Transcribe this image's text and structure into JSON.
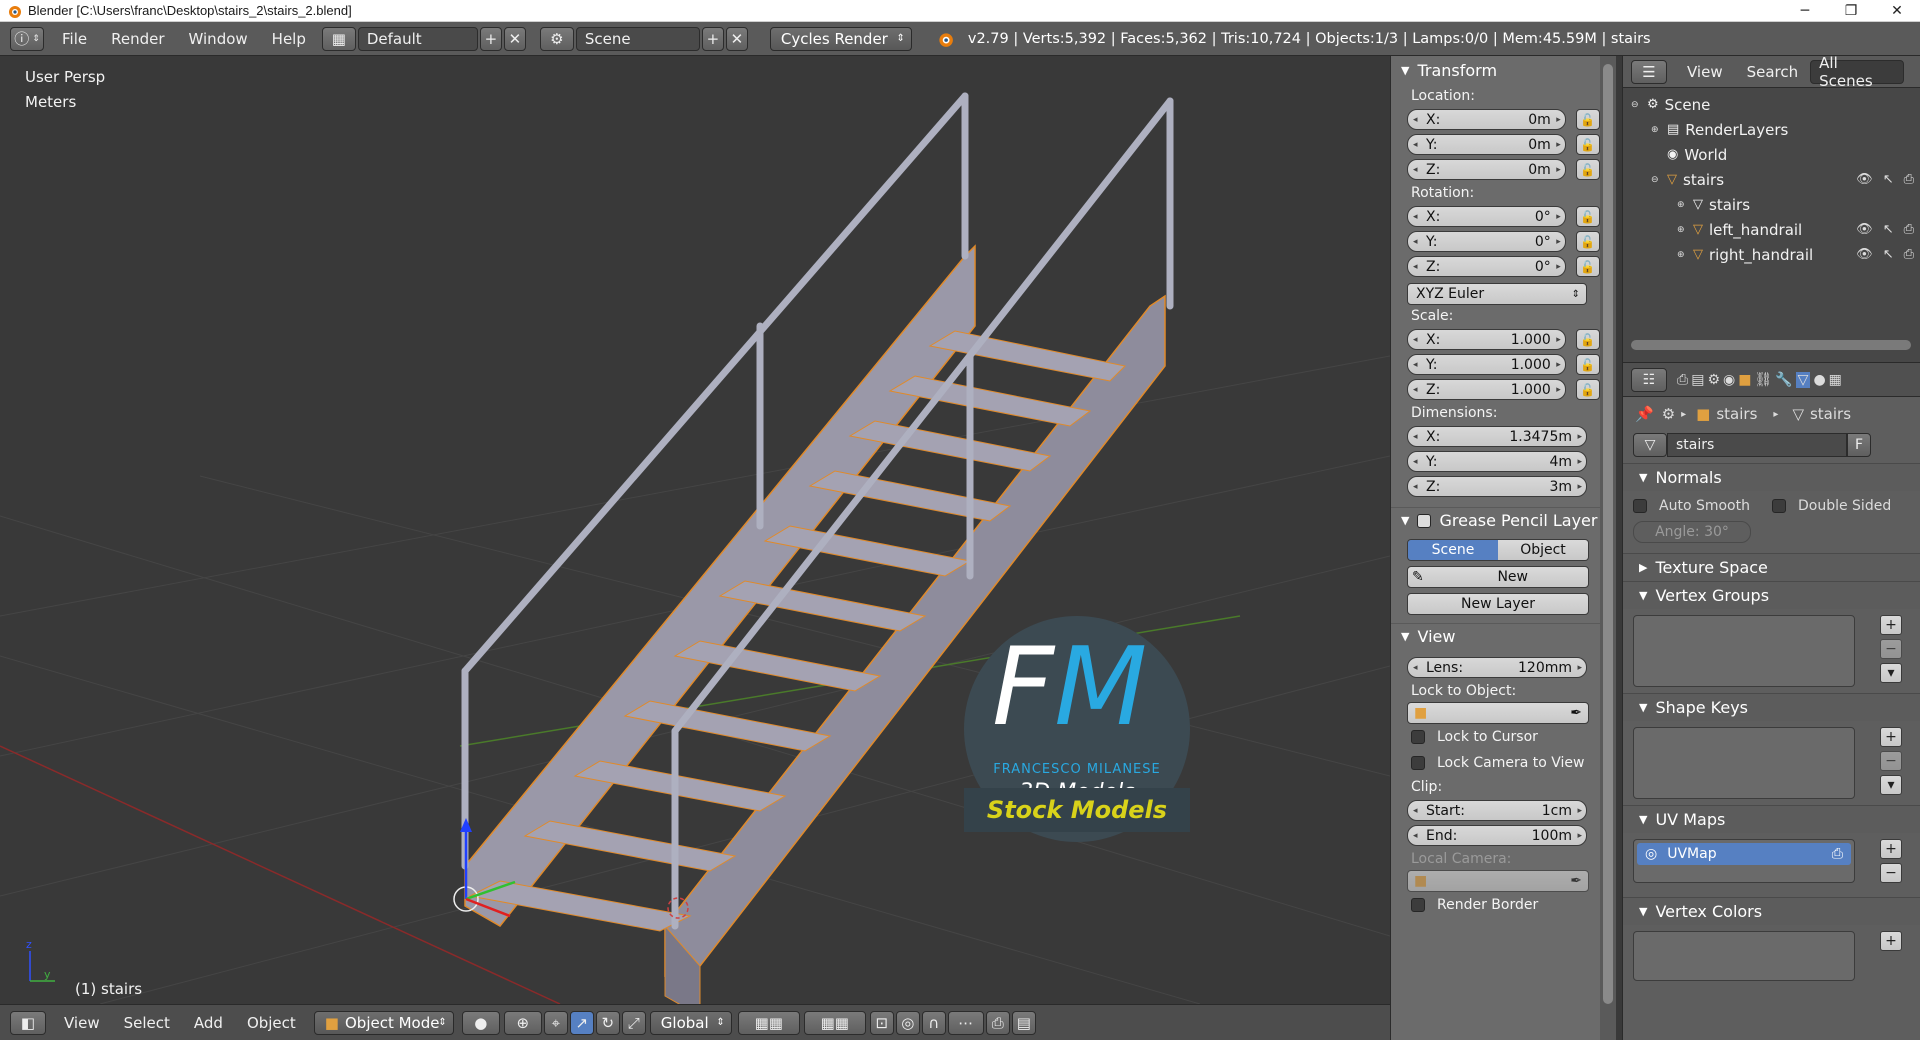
{
  "window": {
    "title": "Blender  [C:\\Users\\franc\\Desktop\\stairs_2\\stairs_2.blend]",
    "minimize": "─",
    "maximize": "❐",
    "close": "✕"
  },
  "menubar": {
    "items": [
      "File",
      "Render",
      "Window",
      "Help"
    ],
    "layout": "Default",
    "scene": "Scene",
    "engine": "Cycles Render",
    "stats": "v2.79 | Verts:5,392 | Faces:5,362 | Tris:10,724 | Objects:1/3 | Lamps:0/0 | Mem:45.59M | stairs"
  },
  "viewport": {
    "view_name": "User Persp",
    "units": "Meters",
    "object_label": "(1) stairs",
    "watermark": {
      "initials_f": "F",
      "initials_m": "M",
      "name": "FRANCESCO MILANESE",
      "sub": "3D Models",
      "banner": "Stock Models"
    }
  },
  "viewport_toolbar": {
    "items": [
      "View",
      "Select",
      "Add",
      "Object"
    ],
    "mode": "Object Mode",
    "orientation": "Global"
  },
  "npanel": {
    "transform": {
      "title": "Transform",
      "location_label": "Location:",
      "location": [
        {
          "axis": "X:",
          "value": "0m"
        },
        {
          "axis": "Y:",
          "value": "0m"
        },
        {
          "axis": "Z:",
          "value": "0m"
        }
      ],
      "rotation_label": "Rotation:",
      "rotation": [
        {
          "axis": "X:",
          "value": "0°"
        },
        {
          "axis": "Y:",
          "value": "0°"
        },
        {
          "axis": "Z:",
          "value": "0°"
        }
      ],
      "rotation_mode": "XYZ Euler",
      "scale_label": "Scale:",
      "scale": [
        {
          "axis": "X:",
          "value": "1.000"
        },
        {
          "axis": "Y:",
          "value": "1.000"
        },
        {
          "axis": "Z:",
          "value": "1.000"
        }
      ],
      "dimensions_label": "Dimensions:",
      "dimensions": [
        {
          "axis": "X:",
          "value": "1.3475m"
        },
        {
          "axis": "Y:",
          "value": "4m"
        },
        {
          "axis": "Z:",
          "value": "3m"
        }
      ]
    },
    "grease": {
      "title": "Grease Pencil Layer",
      "scene_tab": "Scene",
      "object_tab": "Object",
      "new": "New",
      "new_layer": "New Layer"
    },
    "view": {
      "title": "View",
      "lens_label": "Lens:",
      "lens_value": "120mm",
      "lock_object_label": "Lock to Object:",
      "lock_cursor": "Lock to Cursor",
      "lock_camera": "Lock Camera to View",
      "clip_label": "Clip:",
      "clip_start_label": "Start:",
      "clip_start": "1cm",
      "clip_end_label": "End:",
      "clip_end": "100m",
      "local_camera": "Local Camera:",
      "render_border": "Render Border"
    }
  },
  "outliner": {
    "menu_view": "View",
    "menu_search": "Search",
    "filter": "All Scenes",
    "tree": [
      {
        "label": "Scene"
      },
      {
        "label": "RenderLayers"
      },
      {
        "label": "World"
      },
      {
        "label": "stairs"
      },
      {
        "label": "stairs"
      },
      {
        "label": "left_handrail"
      },
      {
        "label": "right_handrail"
      }
    ]
  },
  "properties": {
    "breadcrumb": [
      "stairs",
      "stairs"
    ],
    "mesh_name": "stairs",
    "fake_user": "F",
    "normals": {
      "title": "Normals",
      "auto_smooth": "Auto Smooth",
      "double_sided": "Double Sided",
      "angle": "Angle:   30°"
    },
    "texture_space": "Texture Space",
    "vertex_groups": "Vertex Groups",
    "shape_keys": "Shape Keys",
    "uv_maps": {
      "title": "UV Maps",
      "item": "UVMap"
    },
    "vertex_colors": "Vertex Colors"
  },
  "colors": {
    "viewport_bg": "#393939",
    "selection_orange": "#e08a2a",
    "accent_blue": "#5680c2",
    "stairs_gray": "#9a98a8"
  }
}
